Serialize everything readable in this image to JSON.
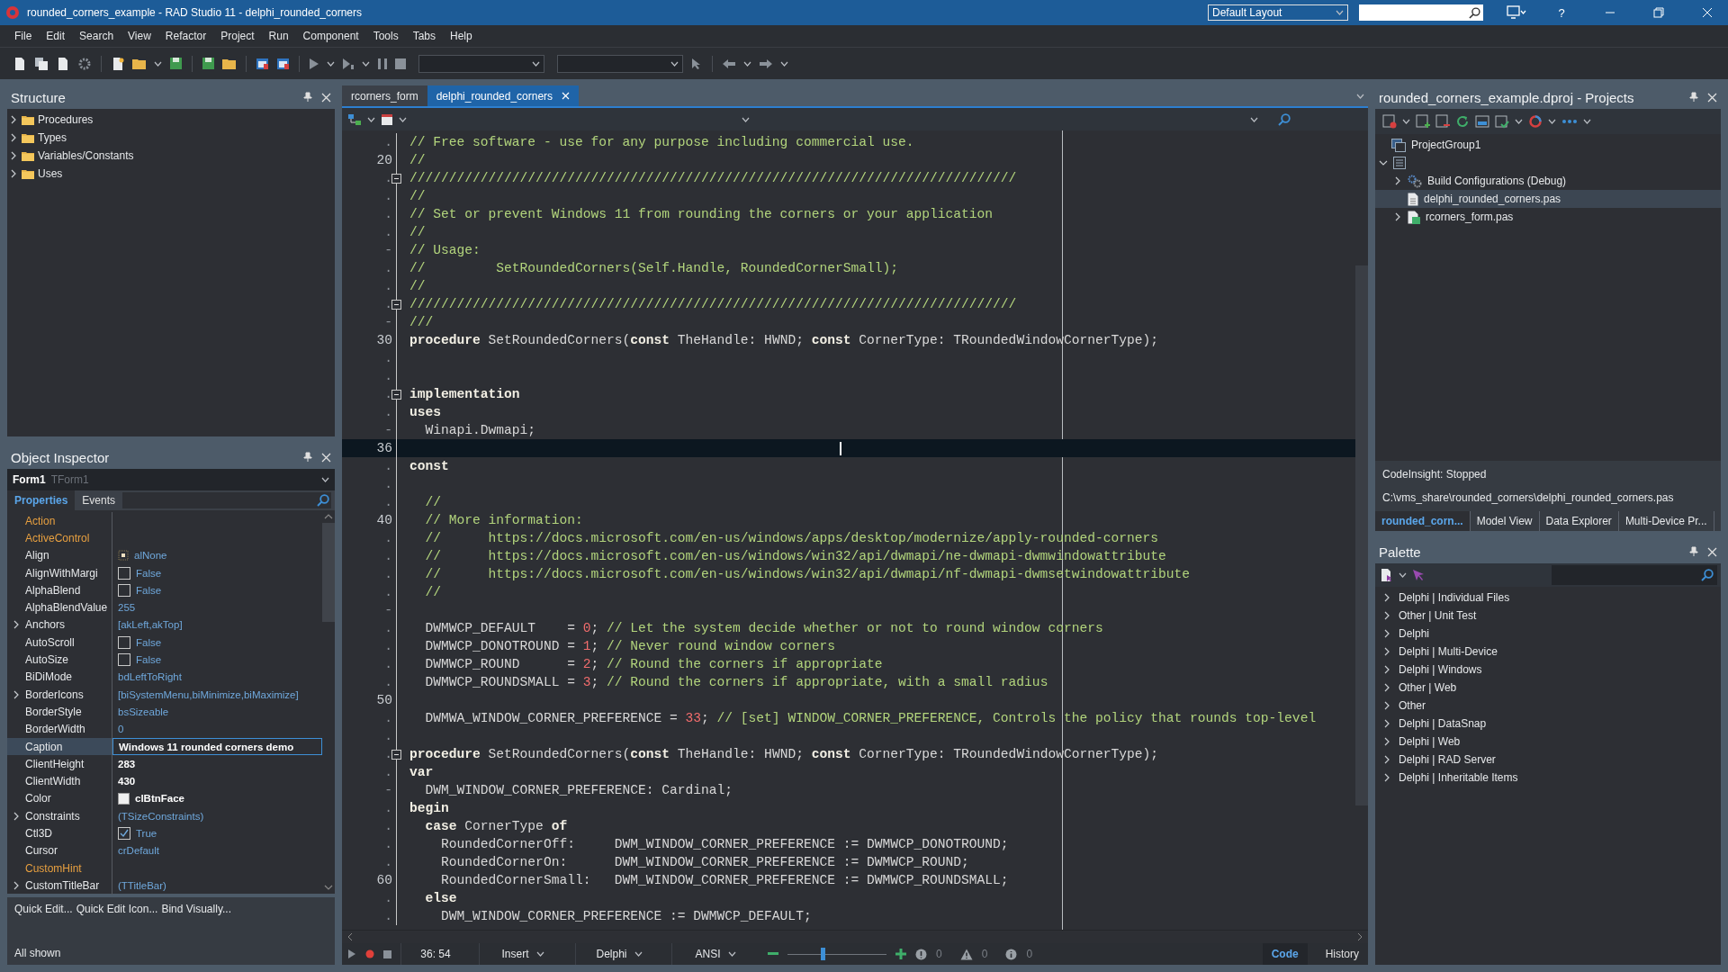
{
  "window": {
    "title": "rounded_corners_example - RAD Studio 11 - delphi_rounded_corners",
    "layout": "Default Layout",
    "help": "?"
  },
  "menu": [
    "File",
    "Edit",
    "Search",
    "View",
    "Refactor",
    "Project",
    "Run",
    "Component",
    "Tools",
    "Tabs",
    "Help"
  ],
  "structure": {
    "title": "Structure",
    "items": [
      {
        "label": "Procedures",
        "expanded": false
      },
      {
        "label": "Types",
        "expanded": false
      },
      {
        "label": "Variables/Constants",
        "expanded": false
      },
      {
        "label": "Uses",
        "expanded": false
      }
    ]
  },
  "object_inspector": {
    "title": "Object Inspector",
    "object": "Form1",
    "class": "TForm1",
    "tabs": [
      {
        "label": "Properties",
        "selected": true
      },
      {
        "label": "Events",
        "selected": false
      }
    ],
    "properties": [
      {
        "name": "Action",
        "kind": "text",
        "expandable": false,
        "reference": true,
        "selected": false
      },
      {
        "name": "ActiveControl",
        "kind": "text",
        "expandable": false,
        "reference": true,
        "selected": false
      },
      {
        "name": "Align",
        "value": "alNone",
        "kind": "align",
        "expandable": false,
        "reference": false,
        "modified": false,
        "selected": false
      },
      {
        "name": "AlignWithMargi",
        "value": "False",
        "kind": "checkbox",
        "checked": false,
        "expandable": false,
        "reference": false,
        "modified": false,
        "selected": false
      },
      {
        "name": "AlphaBlend",
        "value": "False",
        "kind": "checkbox",
        "checked": false,
        "expandable": false,
        "reference": false,
        "modified": false,
        "selected": false
      },
      {
        "name": "AlphaBlendValue",
        "value": "255",
        "kind": "text",
        "expandable": false,
        "reference": false,
        "modified": false,
        "selected": false
      },
      {
        "name": "Anchors",
        "value": "[akLeft,akTop]",
        "kind": "text",
        "expandable": true,
        "reference": false,
        "modified": false,
        "selected": false
      },
      {
        "name": "AutoScroll",
        "value": "False",
        "kind": "checkbox",
        "checked": false,
        "expandable": false,
        "reference": false,
        "modified": false,
        "selected": false
      },
      {
        "name": "AutoSize",
        "value": "False",
        "kind": "checkbox",
        "checked": false,
        "expandable": false,
        "reference": false,
        "modified": false,
        "selected": false
      },
      {
        "name": "BiDiMode",
        "value": "bdLeftToRight",
        "kind": "text",
        "expandable": false,
        "reference": false,
        "modified": false,
        "selected": false
      },
      {
        "name": "BorderIcons",
        "value": "[biSystemMenu,biMinimize,biMaximize]",
        "kind": "text",
        "expandable": true,
        "reference": false,
        "modified": false,
        "selected": false
      },
      {
        "name": "BorderStyle",
        "value": "bsSizeable",
        "kind": "text",
        "expandable": false,
        "reference": false,
        "modified": false,
        "selected": false
      },
      {
        "name": "BorderWidth",
        "value": "0",
        "kind": "text",
        "expandable": false,
        "reference": false,
        "modified": false,
        "selected": false
      },
      {
        "name": "Caption",
        "value": "Windows 11 rounded corners demo",
        "kind": "text",
        "expandable": false,
        "reference": false,
        "modified": true,
        "selected": true
      },
      {
        "name": "ClientHeight",
        "value": "283",
        "kind": "text",
        "expandable": false,
        "reference": false,
        "modified": true,
        "selected": false
      },
      {
        "name": "ClientWidth",
        "value": "430",
        "kind": "text",
        "expandable": false,
        "reference": false,
        "modified": true,
        "selected": false
      },
      {
        "name": "Color",
        "value": "clBtnFace",
        "kind": "color",
        "color": "#f0f0f0",
        "expandable": false,
        "reference": false,
        "modified": true,
        "selected": false
      },
      {
        "name": "Constraints",
        "value": "(TSizeConstraints)",
        "kind": "text",
        "expandable": true,
        "reference": false,
        "modified": false,
        "selected": false
      },
      {
        "name": "Ctl3D",
        "value": "True",
        "kind": "checkbox",
        "checked": true,
        "expandable": false,
        "reference": false,
        "modified": false,
        "selected": false
      },
      {
        "name": "Cursor",
        "value": "crDefault",
        "kind": "text",
        "expandable": false,
        "reference": false,
        "modified": false,
        "selected": false
      },
      {
        "name": "CustomHint",
        "kind": "text",
        "expandable": false,
        "reference": true,
        "selected": false
      },
      {
        "name": "CustomTitleBar",
        "value": "(TTitleBar)",
        "kind": "text",
        "expandable": true,
        "reference": false,
        "modified": false,
        "selected": false
      }
    ],
    "links": [
      "Quick Edit...",
      "Quick Edit Icon...",
      "Bind Visually..."
    ],
    "status": "All shown"
  },
  "editor": {
    "tabs": [
      {
        "label": "rcorners_form",
        "selected": false
      },
      {
        "label": "delphi_rounded_corners",
        "selected": true
      }
    ],
    "lines": [
      {
        "gutter": ".",
        "fold": false,
        "current": false,
        "segments": [
          {
            "kind": "comment",
            "text": "// Free software - use for any purpose including commercial use."
          }
        ]
      },
      {
        "gutter": "20",
        "fold": false,
        "current": false,
        "segments": [
          {
            "kind": "comment",
            "text": "//"
          }
        ]
      },
      {
        "gutter": ".",
        "fold": true,
        "current": false,
        "segments": [
          {
            "kind": "comment",
            "text": "/////////////////////////////////////////////////////////////////////////////"
          }
        ]
      },
      {
        "gutter": ".",
        "fold": false,
        "current": false,
        "segments": [
          {
            "kind": "comment",
            "text": "//"
          }
        ]
      },
      {
        "gutter": ".",
        "fold": false,
        "current": false,
        "segments": [
          {
            "kind": "comment",
            "text": "// Set or prevent Windows 11 from rounding the corners or your application"
          }
        ]
      },
      {
        "gutter": ".",
        "fold": false,
        "current": false,
        "segments": [
          {
            "kind": "comment",
            "text": "//"
          }
        ]
      },
      {
        "gutter": "-",
        "fold": false,
        "current": false,
        "segments": [
          {
            "kind": "comment",
            "text": "// Usage:"
          }
        ]
      },
      {
        "gutter": ".",
        "fold": false,
        "current": false,
        "segments": [
          {
            "kind": "comment",
            "text": "//         SetRoundedCorners(Self.Handle, RoundedCornerSmall);"
          }
        ]
      },
      {
        "gutter": ".",
        "fold": false,
        "current": false,
        "segments": [
          {
            "kind": "comment",
            "text": "//"
          }
        ]
      },
      {
        "gutter": ".",
        "fold": true,
        "current": false,
        "segments": [
          {
            "kind": "comment",
            "text": "/////////////////////////////////////////////////////////////////////////////"
          }
        ]
      },
      {
        "gutter": "-",
        "fold": false,
        "current": false,
        "segments": [
          {
            "kind": "comment",
            "text": "///"
          }
        ]
      },
      {
        "gutter": "30",
        "fold": false,
        "current": false,
        "segments": [
          {
            "kind": "keyword",
            "text": "procedure"
          },
          {
            "kind": "text",
            "text": " SetRoundedCorners("
          },
          {
            "kind": "keyword",
            "text": "const"
          },
          {
            "kind": "text",
            "text": " TheHandle: HWND; "
          },
          {
            "kind": "keyword",
            "text": "const"
          },
          {
            "kind": "text",
            "text": " CornerType: TRoundedWindowCornerType);"
          }
        ]
      },
      {
        "gutter": ".",
        "fold": false,
        "current": false
      },
      {
        "gutter": ".",
        "fold": false,
        "current": false
      },
      {
        "gutter": ".",
        "fold": true,
        "current": false,
        "segments": [
          {
            "kind": "keyword",
            "text": "implementation"
          }
        ]
      },
      {
        "gutter": ".",
        "fold": false,
        "current": false,
        "segments": [
          {
            "kind": "keyword",
            "text": "uses"
          }
        ]
      },
      {
        "gutter": "-",
        "fold": false,
        "current": false,
        "segments": [
          {
            "kind": "text",
            "text": "  Winapi.Dwmapi;"
          }
        ]
      },
      {
        "gutter": "36",
        "fold": false,
        "current": true
      },
      {
        "gutter": ".",
        "fold": false,
        "current": false,
        "segments": [
          {
            "kind": "keyword",
            "text": "const"
          }
        ]
      },
      {
        "gutter": ".",
        "fold": false,
        "current": false
      },
      {
        "gutter": ".",
        "fold": false,
        "current": false,
        "segments": [
          {
            "kind": "comment",
            "text": "  //"
          }
        ]
      },
      {
        "gutter": "40",
        "fold": false,
        "current": false,
        "segments": [
          {
            "kind": "comment",
            "text": "  // More information:"
          }
        ]
      },
      {
        "gutter": ".",
        "fold": false,
        "current": false,
        "segments": [
          {
            "kind": "comment",
            "text": "  //      https://docs.microsoft.com/en-us/windows/apps/desktop/modernize/apply-rounded-corners"
          }
        ]
      },
      {
        "gutter": ".",
        "fold": false,
        "current": false,
        "segments": [
          {
            "kind": "comment",
            "text": "  //      https://docs.microsoft.com/en-us/windows/win32/api/dwmapi/ne-dwmapi-dwmwindowattribute"
          }
        ]
      },
      {
        "gutter": ".",
        "fold": false,
        "current": false,
        "segments": [
          {
            "kind": "comment",
            "text": "  //      https://docs.microsoft.com/en-us/windows/win32/api/dwmapi/nf-dwmapi-dwmsetwindowattribute"
          }
        ]
      },
      {
        "gutter": ".",
        "fold": false,
        "current": false,
        "segments": [
          {
            "kind": "comment",
            "text": "  //"
          }
        ]
      },
      {
        "gutter": "-",
        "fold": false,
        "current": false
      },
      {
        "gutter": ".",
        "fold": false,
        "current": false,
        "segments": [
          {
            "kind": "text",
            "text": "  DWMWCP_DEFAULT    = "
          },
          {
            "kind": "number",
            "text": "0"
          },
          {
            "kind": "text",
            "text": "; "
          },
          {
            "kind": "comment",
            "text": "// Let the system decide whether or not to round window corners"
          }
        ]
      },
      {
        "gutter": ".",
        "fold": false,
        "current": false,
        "segments": [
          {
            "kind": "text",
            "text": "  DWMWCP_DONOTROUND = "
          },
          {
            "kind": "number",
            "text": "1"
          },
          {
            "kind": "text",
            "text": "; "
          },
          {
            "kind": "comment",
            "text": "// Never round window corners"
          }
        ]
      },
      {
        "gutter": ".",
        "fold": false,
        "current": false,
        "segments": [
          {
            "kind": "text",
            "text": "  DWMWCP_ROUND      = "
          },
          {
            "kind": "number",
            "text": "2"
          },
          {
            "kind": "text",
            "text": "; "
          },
          {
            "kind": "comment",
            "text": "// Round the corners if appropriate"
          }
        ]
      },
      {
        "gutter": ".",
        "fold": false,
        "current": false,
        "segments": [
          {
            "kind": "text",
            "text": "  DWMWCP_ROUNDSMALL = "
          },
          {
            "kind": "number",
            "text": "3"
          },
          {
            "kind": "text",
            "text": "; "
          },
          {
            "kind": "comment",
            "text": "// Round the corners if appropriate, with a small radius"
          }
        ]
      },
      {
        "gutter": "50",
        "fold": false,
        "current": false
      },
      {
        "gutter": ".",
        "fold": false,
        "current": false,
        "segments": [
          {
            "kind": "text",
            "text": "  DWMWA_WINDOW_CORNER_PREFERENCE = "
          },
          {
            "kind": "number",
            "text": "33"
          },
          {
            "kind": "text",
            "text": "; "
          },
          {
            "kind": "comment",
            "text": "// [set] WINDOW_CORNER_PREFERENCE, Controls the policy that rounds top-level"
          }
        ]
      },
      {
        "gutter": ".",
        "fold": false,
        "current": false
      },
      {
        "gutter": ".",
        "fold": true,
        "current": false,
        "segments": [
          {
            "kind": "keyword",
            "text": "procedure"
          },
          {
            "kind": "text",
            "text": " SetRoundedCorners("
          },
          {
            "kind": "keyword",
            "text": "const"
          },
          {
            "kind": "text",
            "text": " TheHandle: HWND; "
          },
          {
            "kind": "keyword",
            "text": "const"
          },
          {
            "kind": "text",
            "text": " CornerType: TRoundedWindowCornerType);"
          }
        ]
      },
      {
        "gutter": ".",
        "fold": false,
        "current": false,
        "segments": [
          {
            "kind": "keyword",
            "text": "var"
          }
        ]
      },
      {
        "gutter": "-",
        "fold": false,
        "current": false,
        "segments": [
          {
            "kind": "text",
            "text": "  DWM_WINDOW_CORNER_PREFERENCE: Cardinal;"
          }
        ]
      },
      {
        "gutter": ".",
        "fold": false,
        "current": false,
        "segments": [
          {
            "kind": "keyword",
            "text": "begin"
          }
        ]
      },
      {
        "gutter": ".",
        "fold": false,
        "current": false,
        "segments": [
          {
            "kind": "keyword",
            "text": "  case"
          },
          {
            "kind": "text",
            "text": " CornerType "
          },
          {
            "kind": "keyword",
            "text": "of"
          }
        ]
      },
      {
        "gutter": ".",
        "fold": false,
        "current": false,
        "segments": [
          {
            "kind": "text",
            "text": "    RoundedCornerOff:     DWM_WINDOW_CORNER_PREFERENCE := DWMWCP_DONOTROUND;"
          }
        ]
      },
      {
        "gutter": ".",
        "fold": false,
        "current": false,
        "segments": [
          {
            "kind": "text",
            "text": "    RoundedCornerOn:      DWM_WINDOW_CORNER_PREFERENCE := DWMWCP_ROUND;"
          }
        ]
      },
      {
        "gutter": "60",
        "fold": false,
        "current": false,
        "segments": [
          {
            "kind": "text",
            "text": "    RoundedCornerSmall:   DWM_WINDOW_CORNER_PREFERENCE := DWMWCP_ROUNDSMALL;"
          }
        ]
      },
      {
        "gutter": ".",
        "fold": false,
        "current": false,
        "segments": [
          {
            "kind": "keyword",
            "text": "  else"
          }
        ]
      },
      {
        "gutter": ".",
        "fold": false,
        "current": false,
        "segments": [
          {
            "kind": "text",
            "text": "    DWM_WINDOW_CORNER_PREFERENCE := DWMWCP_DEFAULT;"
          }
        ]
      }
    ]
  },
  "status_bar": {
    "position": "36: 54",
    "mode": "Insert",
    "language": "Delphi",
    "encoding": "ANSI",
    "zoom": {
      "level": 0.35
    },
    "counts": [
      {
        "kind": "error",
        "value": "0"
      },
      {
        "kind": "warning",
        "value": "0"
      },
      {
        "kind": "info",
        "value": "0"
      }
    ],
    "views": [
      {
        "label": "Code",
        "selected": true
      },
      {
        "label": "History",
        "selected": false
      }
    ]
  },
  "projects": {
    "title": "rounded_corners_example.dproj - Projects",
    "tree": [
      {
        "label": "ProjectGroup1",
        "kind": "group",
        "selected": false,
        "children": [
          {
            "kind": "project",
            "expanded": true,
            "selected": false,
            "children": [
              {
                "label": "Build Configurations (Debug)",
                "kind": "config",
                "expanded": false,
                "selected": false
              },
              {
                "label": "delphi_rounded_corners.pas",
                "kind": "file",
                "selected": true
              },
              {
                "label": "rcorners_form.pas",
                "kind": "form",
                "expanded": false,
                "selected": false
              }
            ]
          }
        ]
      }
    ],
    "status": "CodeInsight: Stopped",
    "path": "C:\\vms_share\\rounded_corners\\delphi_rounded_corners.pas",
    "tabs": [
      {
        "label": "rounded_corn...",
        "selected": true
      },
      {
        "label": "Model View",
        "selected": false
      },
      {
        "label": "Data Explorer",
        "selected": false
      },
      {
        "label": "Multi-Device Pr...",
        "selected": false
      }
    ]
  },
  "palette": {
    "title": "Palette",
    "items": [
      "Delphi | Individual Files",
      "Other | Unit Test",
      "Delphi",
      "Delphi | Multi-Device",
      "Delphi | Windows",
      "Other | Web",
      "Other",
      "Delphi | DataSnap",
      "Delphi | Web",
      "Delphi | RAD Server",
      "Delphi | Inheritable Items"
    ]
  }
}
